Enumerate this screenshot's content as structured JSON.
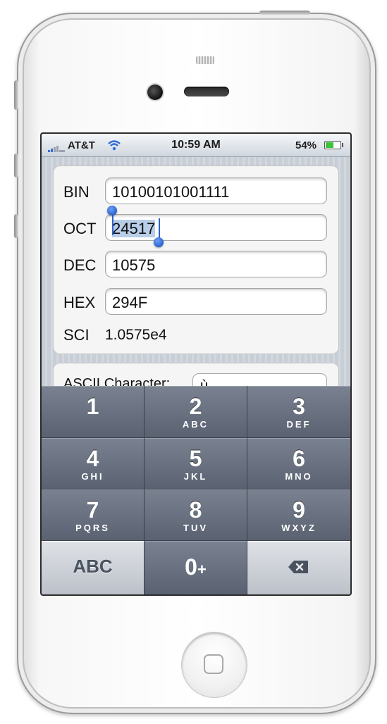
{
  "status_bar": {
    "carrier": "AT&T",
    "time": "10:59 AM",
    "battery_percent": "54%",
    "battery_level": 0.54,
    "icons": [
      "signal-icon",
      "wifi-icon",
      "battery-icon"
    ]
  },
  "converter": {
    "bin": {
      "label": "BIN",
      "value": "10100101001111"
    },
    "oct": {
      "label": "OCT",
      "value": "24517",
      "selected": true
    },
    "dec": {
      "label": "DEC",
      "value": "10575"
    },
    "hex": {
      "label": "HEX",
      "value": "294F"
    },
    "sci": {
      "label": "SCI",
      "value": "1.0575e4"
    }
  },
  "ascii": {
    "label": "ASCII Character:",
    "value": "ù"
  },
  "keypad": {
    "keys": [
      {
        "digit": "1",
        "letters": ""
      },
      {
        "digit": "2",
        "letters": "ABC"
      },
      {
        "digit": "3",
        "letters": "DEF"
      },
      {
        "digit": "4",
        "letters": "GHI"
      },
      {
        "digit": "5",
        "letters": "JKL"
      },
      {
        "digit": "6",
        "letters": "MNO"
      },
      {
        "digit": "7",
        "letters": "PQRS"
      },
      {
        "digit": "8",
        "letters": "TUV"
      },
      {
        "digit": "9",
        "letters": "WXYZ"
      }
    ],
    "abc_label": "ABC",
    "zero_label": "0",
    "zero_plus": "+",
    "backspace_icon": "backspace-icon"
  },
  "colors": {
    "selection": "#b8cde8",
    "selection_handle": "#2d65d1",
    "keypad_dark": "#5a6272",
    "keypad_light": "#bcc1c9"
  }
}
